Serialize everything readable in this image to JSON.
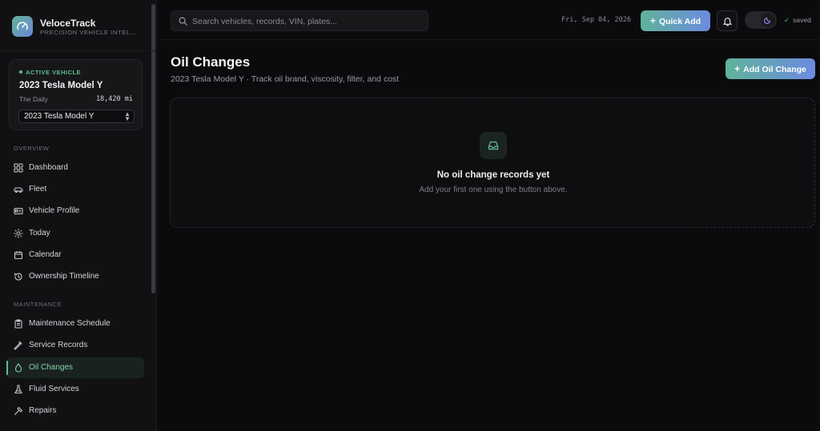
{
  "brand": {
    "name": "VeloceTrack",
    "tagline": "PRECISION VEHICLE INTELLIGENCE",
    "logo_icon": "speedometer-icon"
  },
  "active_vehicle": {
    "label": "ACTIVE VEHICLE",
    "title": "2023 Tesla Model Y",
    "nickname": "The Daily",
    "mileage": "18,420 mi",
    "selector_value": "2023 Tesla Model Y"
  },
  "sidebar": {
    "sections": [
      {
        "title": "OVERVIEW",
        "items": [
          {
            "label": "Dashboard",
            "icon": "grid-icon"
          },
          {
            "label": "Fleet",
            "icon": "car-icon"
          },
          {
            "label": "Vehicle Profile",
            "icon": "id-card-icon"
          },
          {
            "label": "Today",
            "icon": "sun-icon"
          },
          {
            "label": "Calendar",
            "icon": "calendar-icon"
          },
          {
            "label": "Ownership Timeline",
            "icon": "history-icon"
          }
        ]
      },
      {
        "title": "MAINTENANCE",
        "items": [
          {
            "label": "Maintenance Schedule",
            "icon": "clipboard-icon"
          },
          {
            "label": "Service Records",
            "icon": "wrench-icon"
          },
          {
            "label": "Oil Changes",
            "icon": "droplet-icon",
            "active": true
          },
          {
            "label": "Fluid Services",
            "icon": "flask-icon"
          },
          {
            "label": "Repairs",
            "icon": "hammer-icon"
          }
        ]
      }
    ]
  },
  "topbar": {
    "search_placeholder": "Search vehicles, records, VIN, plates...",
    "date": "Fri, Sep 04, 2026",
    "quick_add_label": "Quick Add",
    "saved_label": "saved"
  },
  "main": {
    "title": "Oil Changes",
    "subtitle": "2023 Tesla Model Y · Track oil brand, viscosity, filter, and cost",
    "add_button_label": "Add Oil Change",
    "empty_state": {
      "title": "No oil change records yet",
      "subtitle": "Add your first one using the button above."
    }
  },
  "colors": {
    "accent_green": "#5cc08f",
    "accent_gradient_start": "#5fb39a",
    "accent_gradient_end": "#6c8be0",
    "background": "#0b0b0d"
  }
}
